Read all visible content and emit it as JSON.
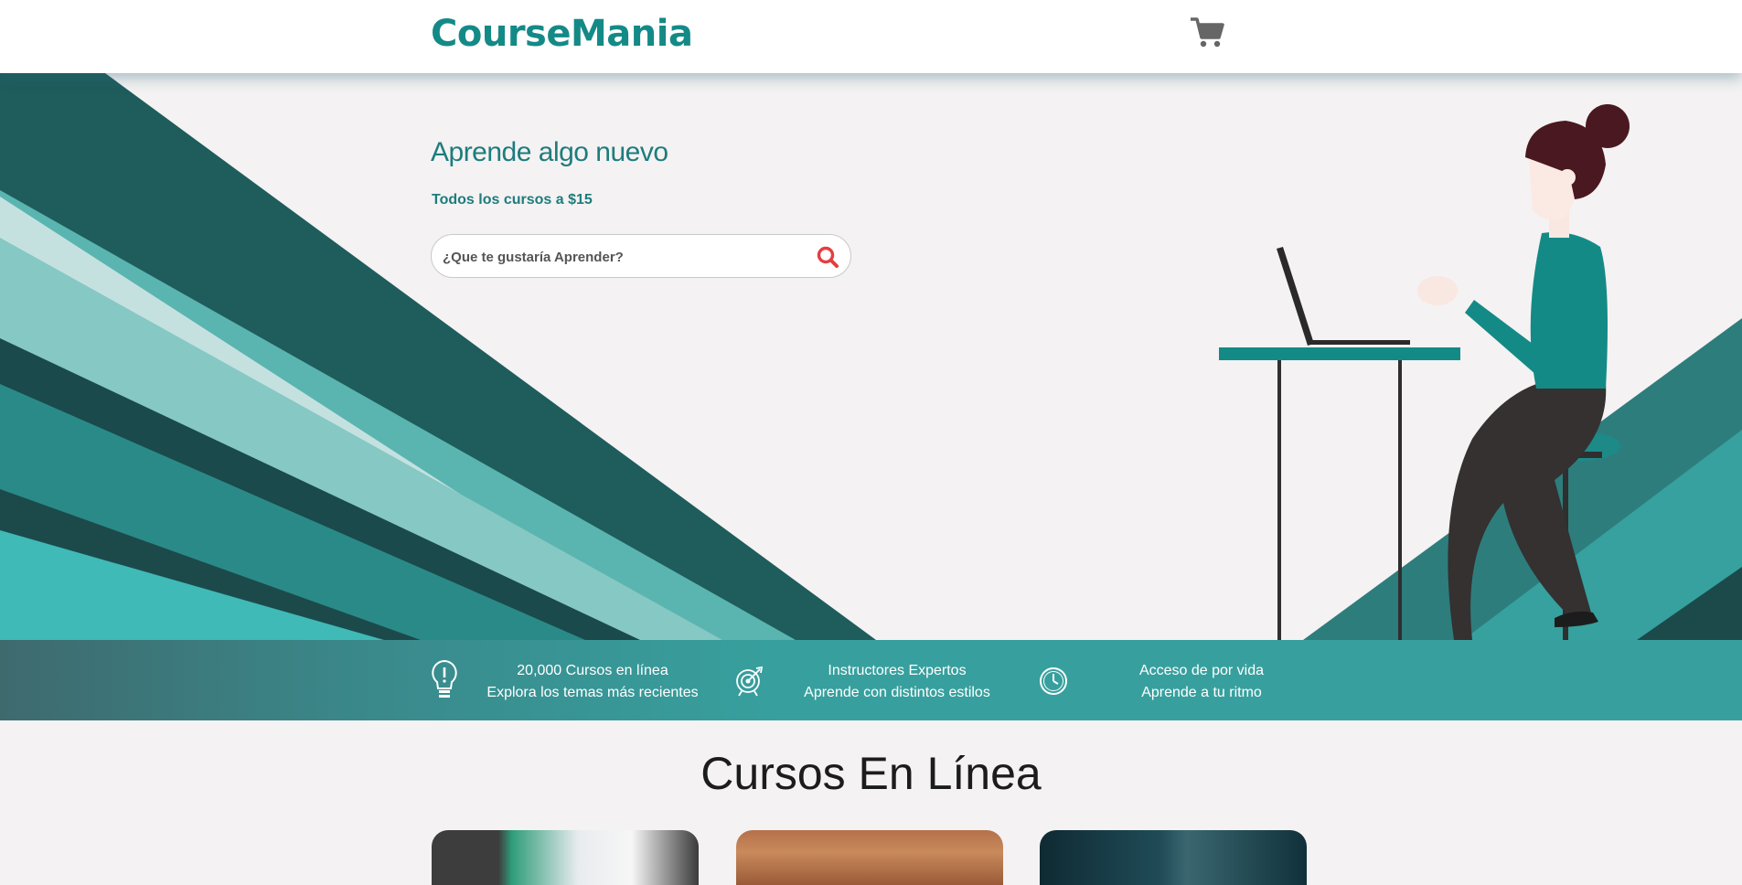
{
  "header": {
    "logo": "CourseMania",
    "cart_icon": "shopping-cart-icon"
  },
  "hero": {
    "title": "Aprende algo nuevo",
    "subtitle": "Todos los cursos a $15",
    "search": {
      "placeholder": "¿Que te gustaría Aprender?",
      "value": "",
      "button_icon": "search-icon"
    }
  },
  "features": [
    {
      "icon": "lightbulb-icon",
      "line1": "20,000 Cursos en línea",
      "line2": "Explora los temas más recientes"
    },
    {
      "icon": "target-icon",
      "line1": "Instructores Expertos",
      "line2": "Aprende con distintos estilos"
    },
    {
      "icon": "clock-icon",
      "line1": "Acceso de por vida",
      "line2": "Aprende a tu ritmo"
    }
  ],
  "courses": {
    "title": "Cursos En Línea"
  },
  "colors": {
    "brand": "#148a87",
    "accent_red": "#e53e3e",
    "band": "#37a09e"
  }
}
